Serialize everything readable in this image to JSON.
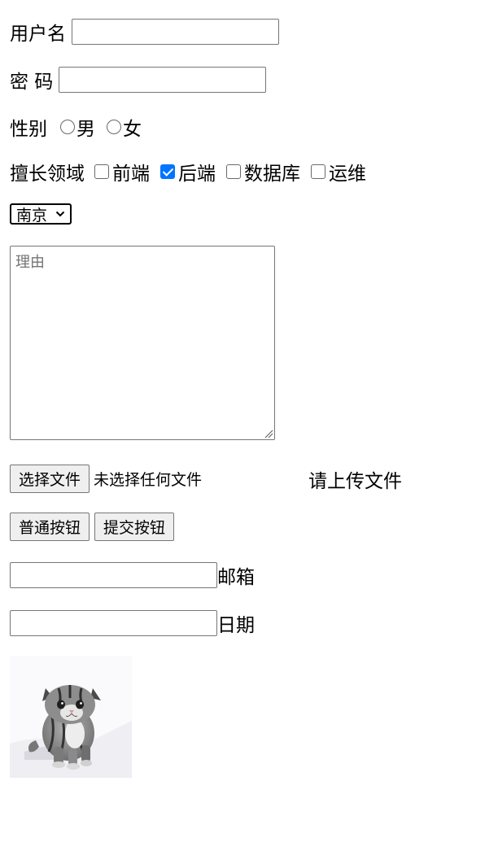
{
  "form": {
    "username": {
      "label": "用户名",
      "value": ""
    },
    "password": {
      "label": "密 码",
      "value": ""
    },
    "gender": {
      "label": "性别",
      "options": [
        "男",
        "女"
      ],
      "selected": null
    },
    "expertise": {
      "label": "擅长领域",
      "options": [
        {
          "label": "前端",
          "checked": false
        },
        {
          "label": "后端",
          "checked": true
        },
        {
          "label": "数据库",
          "checked": false
        },
        {
          "label": "运维",
          "checked": false
        }
      ]
    },
    "city": {
      "selected": "南京"
    },
    "reason": {
      "placeholder": "理由",
      "value": ""
    },
    "upload": {
      "button_label": "选择文件",
      "status": "未选择任何文件",
      "hint": "请上传文件"
    },
    "buttons": {
      "normal": "普通按钮",
      "submit": "提交按钮"
    },
    "email": {
      "label": "邮箱",
      "value": ""
    },
    "date": {
      "label": "日期",
      "value": ""
    }
  },
  "colors": {
    "checkbox_checked": "#0075ff",
    "button_bg": "#efefef",
    "border": "#767676"
  }
}
